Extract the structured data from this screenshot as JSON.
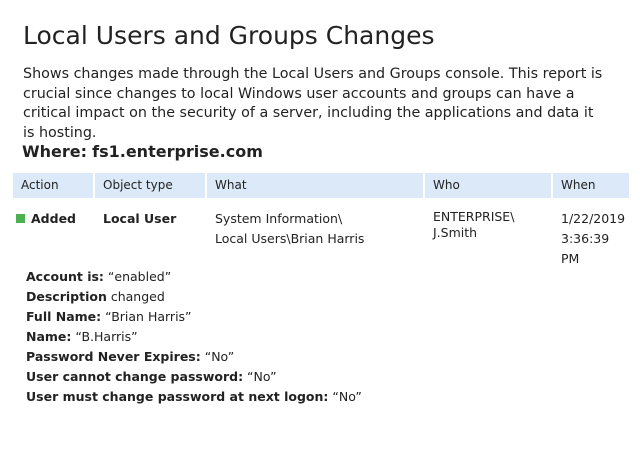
{
  "title": "Local Users and Groups Changes",
  "description": "Shows changes made through the Local Users and Groups console. This report is crucial since changes to local Windows user accounts and groups can have a critical impact on the security of a server, including the applications and data it is hosting.",
  "where": {
    "label": "Where:",
    "value": "fs1.enterprise.com"
  },
  "table": {
    "headers": {
      "action": "Action",
      "object_type": "Object type",
      "what": "What",
      "who": "Who",
      "when": "When"
    },
    "row": {
      "action": "Added",
      "action_color": "#4caf50",
      "object_type": "Local User",
      "what_line1": "System Information\\",
      "what_line2": "Local Users\\Brian Harris",
      "who_line1": "ENTERPRISE\\",
      "who_line2": "J.Smith",
      "when_date": "1/22/2019",
      "when_time": "3:36:39 PM"
    }
  },
  "details": [
    {
      "label": "Account is:",
      "value": " “enabled”"
    },
    {
      "label": "Description",
      "value": " changed"
    },
    {
      "label": "Full Name:",
      "value": " “Brian Harris”"
    },
    {
      "label": "Name:",
      "value": " “B.Harris”"
    },
    {
      "label": "Password Never Expires:",
      "value": " “No”"
    },
    {
      "label": "User cannot change password:",
      "value": " “No”"
    },
    {
      "label": "User must change password at next logon:",
      "value": " “No”"
    }
  ],
  "colors": {
    "header_background": "#dbe9f8",
    "text": "#222222"
  }
}
